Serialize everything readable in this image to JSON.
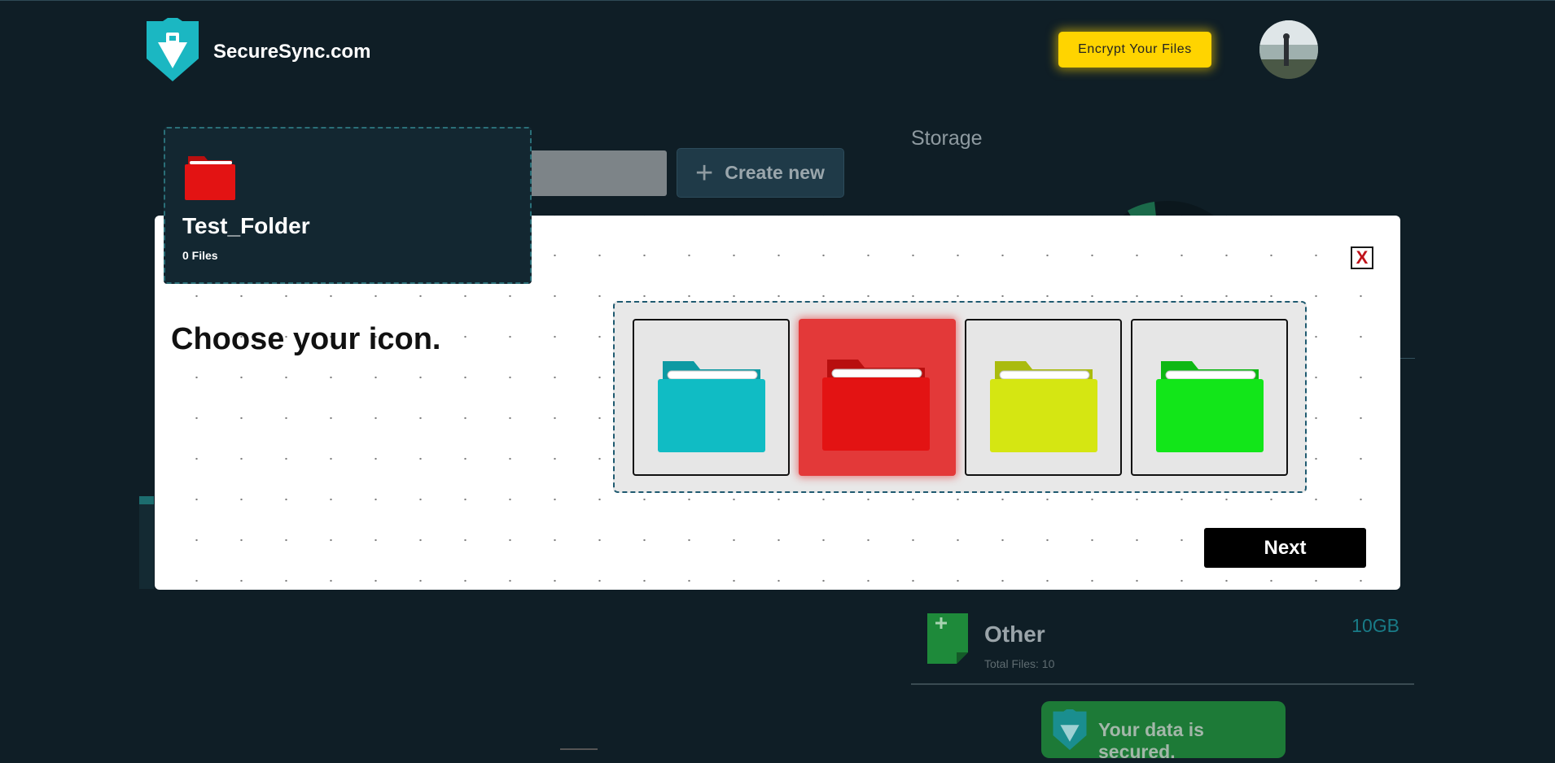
{
  "header": {
    "brand": "SecureSync.com",
    "encrypt_button": "Encrypt Your Files",
    "accent_color": "#ffd400"
  },
  "background": {
    "storage_title": "Storage",
    "create_new_label": "Create new",
    "storage_items": [
      {
        "name": "Other",
        "total_files": "Total Files: 10",
        "size": "10GB",
        "icon": "other-file-icon"
      }
    ],
    "secured_banner": "Your data is secured."
  },
  "folder_card": {
    "name": "Test_Folder",
    "files": "0 Files",
    "color": "#e31313"
  },
  "modal": {
    "title": "Choose your icon.",
    "close_label": "X",
    "next_label": "Next",
    "selected_index": 1,
    "icons": [
      {
        "name": "teal-folder-icon",
        "color": "#10bcc4"
      },
      {
        "name": "red-folder-icon",
        "color": "#e31313"
      },
      {
        "name": "yellow-folder-icon",
        "color": "#d5e612"
      },
      {
        "name": "green-folder-icon",
        "color": "#12e619"
      }
    ]
  }
}
